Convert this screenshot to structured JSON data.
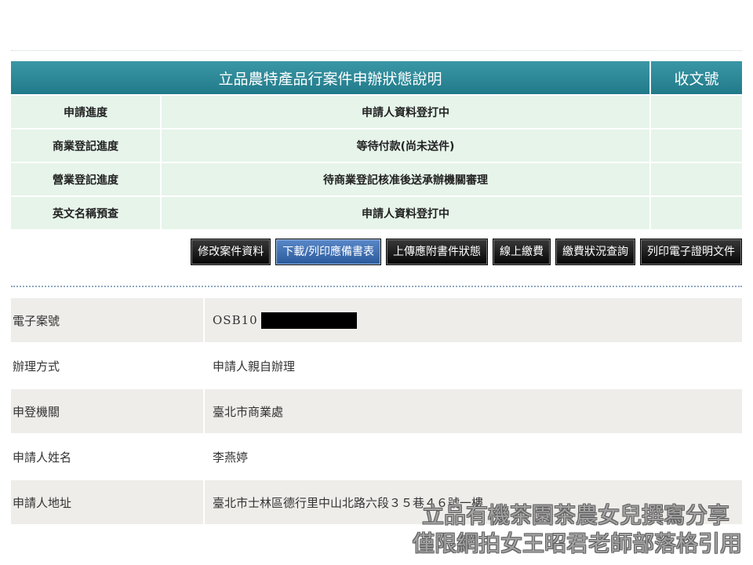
{
  "status": {
    "title": "立品農特產品行案件申辦狀態說明",
    "receipt_header": "收文號",
    "rows": [
      {
        "label": "申請進度",
        "value": "申請人資料登打中",
        "receipt": ""
      },
      {
        "label": "商業登記進度",
        "value": "等待付款(尚未送件)",
        "receipt": ""
      },
      {
        "label": "營業登記進度",
        "value": "待商業登記核准後送承辦機關審理",
        "receipt": ""
      },
      {
        "label": "英文名稱預查",
        "value": "申請人資料登打中",
        "receipt": ""
      }
    ]
  },
  "buttons": [
    {
      "label": "修改案件資料",
      "active": false
    },
    {
      "label": "下載/列印應備書表",
      "active": true
    },
    {
      "label": "上傳應附書件狀態",
      "active": false
    },
    {
      "label": "線上繳費",
      "active": false
    },
    {
      "label": "繳費狀況查詢",
      "active": false
    },
    {
      "label": "列印電子證明文件",
      "active": false
    }
  ],
  "details": {
    "case_no_label": "電子案號",
    "case_no_prefix": "OSB10",
    "method_label": "辦理方式",
    "method_value": "申請人親自辦理",
    "agency_label": "申登機關",
    "agency_value": "臺北市商業處",
    "name_label": "申請人姓名",
    "name_value": "李燕婷",
    "address_label": "申請人地址",
    "address_value": "臺北市士林區德行里中山北路六段３５巷４６號一樓"
  },
  "watermark": {
    "line1": "立品有機茶園茶農女兒撰寫分享",
    "line2": "僅限網拍女王昭君老師部落格引用"
  },
  "colors": {
    "header_teal": "#2a8a99",
    "row_green": "#e6f4ea",
    "button_black": "#111111",
    "button_active_blue": "#3f6fb0",
    "info_row_gray": "#efedea"
  }
}
